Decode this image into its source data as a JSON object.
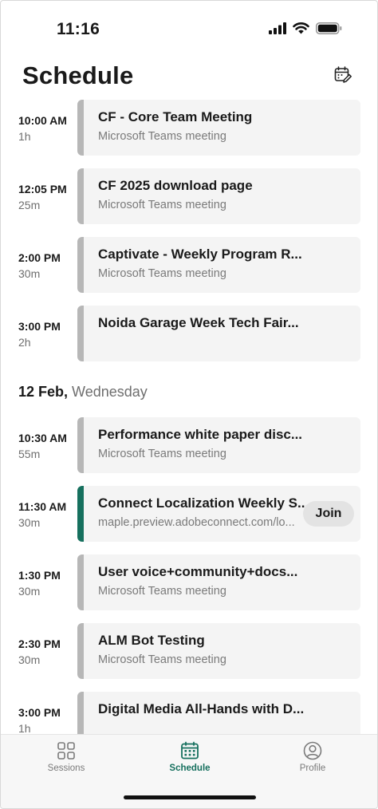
{
  "status_bar": {
    "time": "11:16"
  },
  "header": {
    "title": "Schedule"
  },
  "events": [
    {
      "time": "10:00 AM",
      "duration": "1h",
      "title": "CF - Core Team Meeting",
      "subtitle": "Microsoft Teams meeting"
    },
    {
      "time": "12:05 PM",
      "duration": "25m",
      "title": "CF 2025 download page",
      "subtitle": "Microsoft Teams meeting"
    },
    {
      "time": "2:00 PM",
      "duration": "30m",
      "title": "Captivate - Weekly Program R...",
      "subtitle": "Microsoft Teams meeting"
    },
    {
      "time": "3:00 PM",
      "duration": "2h",
      "title": "Noida Garage Week Tech Fair...",
      "subtitle": ""
    }
  ],
  "day_header": {
    "date": "12 Feb,",
    "weekday": "Wednesday"
  },
  "events_day2": [
    {
      "time": "10:30 AM",
      "duration": "55m",
      "title": "Performance white paper disc...",
      "subtitle": "Microsoft Teams meeting"
    },
    {
      "time": "11:30 AM",
      "duration": "30m",
      "title": "Connect Localization Weekly S...",
      "subtitle": "maple.preview.adobeconnect.com/lo...",
      "join_label": "Join"
    },
    {
      "time": "1:30 PM",
      "duration": "30m",
      "title": "User voice+community+docs...",
      "subtitle": "Microsoft Teams meeting"
    },
    {
      "time": "2:30 PM",
      "duration": "30m",
      "title": "ALM Bot Testing",
      "subtitle": "Microsoft Teams meeting"
    },
    {
      "time": "3:00 PM",
      "duration": "1h",
      "title": "Digital Media All-Hands with D...",
      "subtitle": ""
    }
  ],
  "tabs": [
    {
      "label": "Sessions",
      "icon": "grid-icon"
    },
    {
      "label": "Schedule",
      "icon": "calendar-icon"
    },
    {
      "label": "Profile",
      "icon": "profile-icon"
    }
  ],
  "colors": {
    "accent": "#16705e",
    "card_bar": "#b7b7b7",
    "card_bg": "#f4f4f4"
  }
}
